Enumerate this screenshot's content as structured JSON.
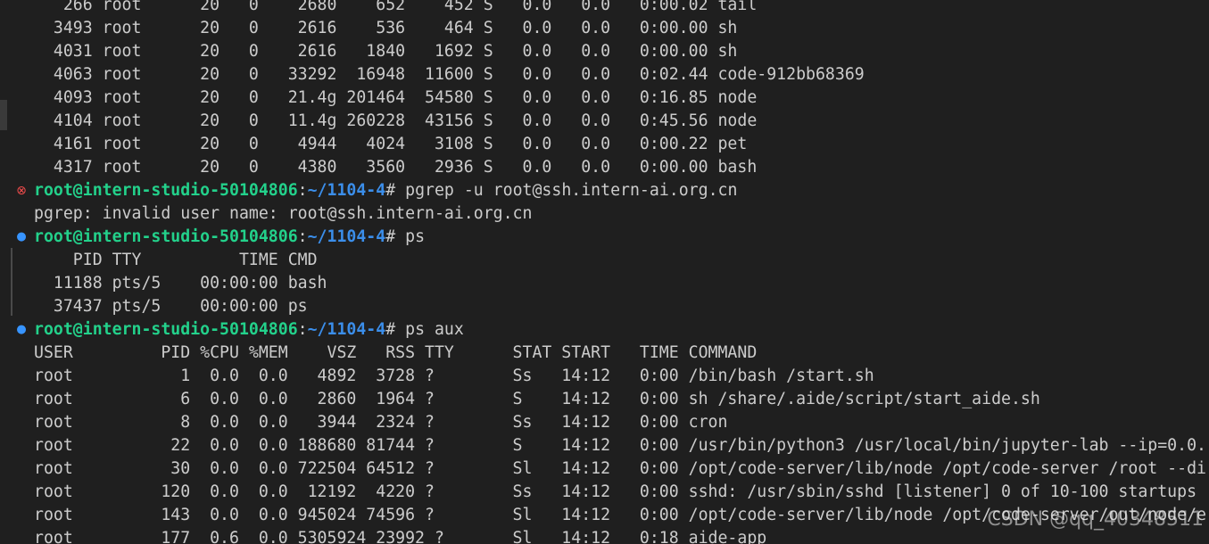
{
  "terminal": {
    "top_rows": [
      "   266 root      20   0    2680    652    452 S   0.0   0.0   0:00.02 tail",
      "  3493 root      20   0    2616    536    464 S   0.0   0.0   0:00.00 sh",
      "  4031 root      20   0    2616   1840   1692 S   0.0   0.0   0:00.00 sh",
      "  4063 root      20   0   33292  16948  11600 S   0.0   0.0   0:02.44 code-912bb68369",
      "  4093 root      20   0   21.4g 201464  54580 S   0.0   0.0   0:16.85 node",
      "  4104 root      20   0   11.4g 260228  43156 S   0.0   0.0   0:45.56 node",
      "  4161 root      20   0    4944   4024   3108 S   0.0   0.0   0:00.22 pet",
      "  4317 root      20   0    4380   3560   2936 S   0.0   0.0   0:00.00 bash"
    ],
    "prompt_user": "root@intern-studio-50104806",
    "prompt_path": "~/1104-4",
    "commands": [
      {
        "status": "error",
        "cmd": "pgrep -u root@ssh.intern-ai.org.cn",
        "output": [
          "pgrep: invalid user name: root@ssh.intern-ai.org.cn"
        ]
      },
      {
        "status": "ok",
        "cmd": "ps",
        "output": [
          "    PID TTY          TIME CMD",
          "  11188 pts/5    00:00:00 bash",
          "  37437 pts/5    00:00:00 ps"
        ]
      },
      {
        "status": "ok",
        "cmd": "ps aux",
        "output": [
          "USER         PID %CPU %MEM    VSZ   RSS TTY      STAT START   TIME COMMAND",
          "root           1  0.0  0.0   4892  3728 ?        Ss   14:12   0:00 /bin/bash /start.sh",
          "root           6  0.0  0.0   2860  1964 ?        S    14:12   0:00 sh /share/.aide/script/start_aide.sh",
          "root           8  0.0  0.0   3944  2324 ?        Ss   14:12   0:00 cron",
          "root          22  0.0  0.0 188680 81744 ?        S    14:12   0:00 /usr/bin/python3 /usr/local/bin/jupyter-lab --ip=0.0.",
          "root          30  0.0  0.0 722504 64512 ?        Sl   14:12   0:00 /opt/code-server/lib/node /opt/code-server /root --di",
          "root         120  0.0  0.0  12192  4220 ?        Ss   14:12   0:00 sshd: /usr/sbin/sshd [listener] 0 of 10-100 startups",
          "root         143  0.0  0.0 945024 74596 ?        Sl   14:12   0:00 /opt/code-server/lib/node /opt/code-server/out/node/e",
          "root         177  0.6  0.0 5305924 23992 ?       Sl   14:12   0:18 aide-app"
        ]
      }
    ]
  },
  "watermark": "CSDN @qq_40348511",
  "colors": {
    "background": "#1f1f1f",
    "text": "#cccccc",
    "prompt_user": "#23d18b",
    "prompt_path": "#3b8eea",
    "error_marker": "#f14c4c",
    "ok_marker": "#3794ff"
  },
  "icons": {
    "error": "circle-x-icon",
    "ok": "circle-dot-icon"
  }
}
